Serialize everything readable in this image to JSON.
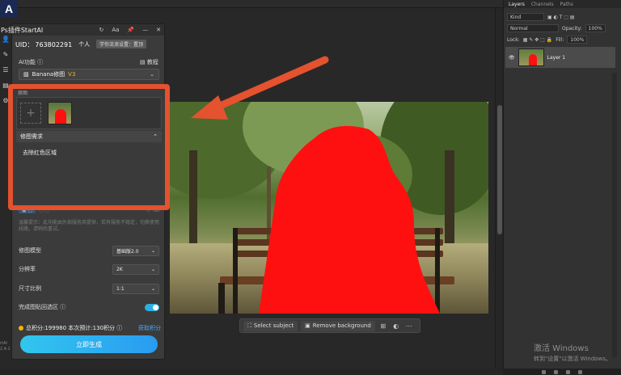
{
  "plugin": {
    "title": "Ps插件StartAI",
    "uid_label": "UID：",
    "uid_value": "763802291",
    "personal": "个人",
    "tooltip": "学你流浪设置：置顶",
    "ai_function_label": "AI功能 ⓘ",
    "tutorial": "教程",
    "mode": "Banana修图",
    "mode_badge": "V3",
    "upload_label": "原图",
    "prompt_header": "修图需求",
    "prompt_text": "去除红色区域",
    "faded_tip": "温馨提示：此功能由外部服务商提供，若有服务不稳定，切换使用线路，请稍后重试。",
    "model_label": "修图模型",
    "model_value": "基础版2.0",
    "resolution_label": "分辨率",
    "resolution_value": "2K",
    "ratio_label": "尺寸比例",
    "ratio_value": "1:1",
    "paste_label": "完成图贴回选区 ⓘ",
    "toggle_on": true,
    "points_text": "总积分:199980  本次预计:130积分 ⓘ",
    "recharge": "获取积分",
    "generate": "立即生成"
  },
  "context_bar": {
    "select_subject": "Select subject",
    "remove_background": "Remove background"
  },
  "layers": {
    "tabs": [
      "Layers",
      "Channels",
      "Paths"
    ],
    "kind": "Kind",
    "blend": "Normal",
    "opacity_label": "Opacity:",
    "opacity_value": "100%",
    "lock_label": "Lock:",
    "fill_label": "Fill:",
    "fill_value": "100%",
    "layer_name": "Layer 1"
  },
  "windows": {
    "activate_title": "激活 Windows",
    "activate_sub": "转到\"设置\"以激活 Windows。"
  },
  "app_logo": "A",
  "side_text": "rtAI\n2.4.1",
  "colors": {
    "highlight": "#e4522f",
    "mask_red": "#ff1010",
    "generate_gradient_start": "#31c6ef",
    "generate_gradient_end": "#2a9bf0",
    "toggle": "#2bb0e0"
  }
}
